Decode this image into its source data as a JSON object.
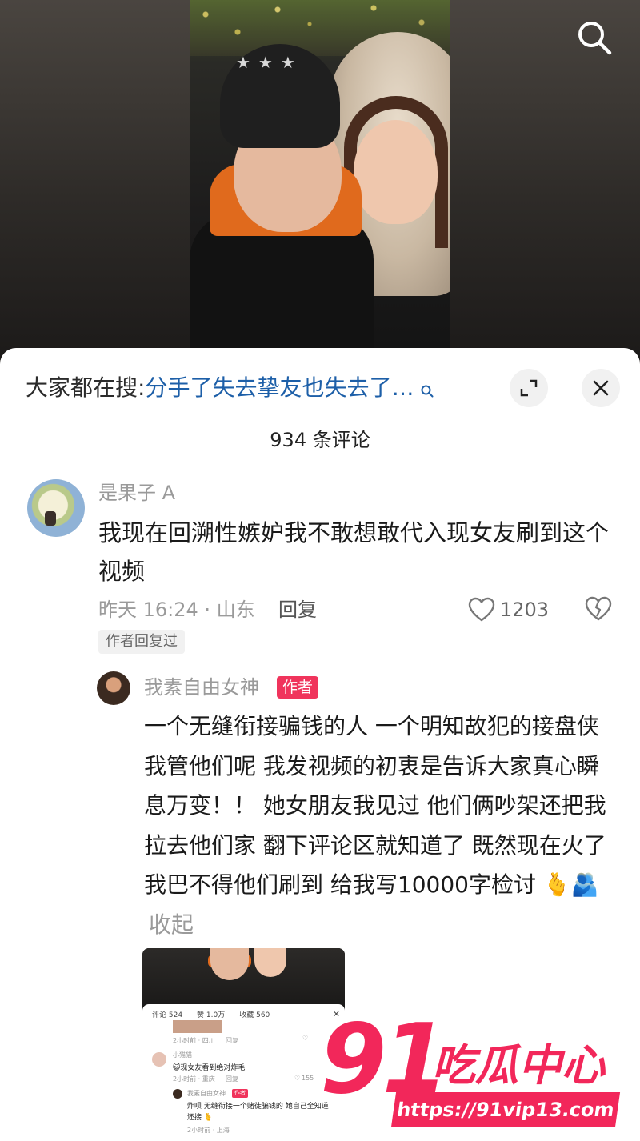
{
  "search": {
    "prefix": "大家都在搜:",
    "query": "分手了失去挚友也失去了…"
  },
  "comments_header": {
    "count_label": "934 条评论"
  },
  "comment": {
    "username": "是果子 A",
    "text": "我现在回溯性嫉妒我不敢想敢代入现女友刷到这个视频",
    "meta": "昨天 16:24 · 山东",
    "reply_label": "回复",
    "likes": "1203",
    "author_replied_tag": "作者回复过"
  },
  "reply": {
    "username": "我素自由女神",
    "author_badge": "作者",
    "text": "一个无缝衔接骗钱的人 一个明知故犯的接盘侠 我管他们呢 我发视频的初衷是告诉大家真心瞬息万变！！ 她女朋友我见过 他们俩吵架还把我拉去他们家 翻下评论区就知道了 既然现在火了 我巴不得他们刷到 给我写10000字检讨",
    "emoji": "🫰🫂",
    "collapse_label": "收起"
  },
  "embedded_screenshot": {
    "tabs": [
      "评论 524",
      "赞 1.0万",
      "收藏 560"
    ],
    "close": "✕",
    "row1_meta": "2小时前 · 四川",
    "row1_reply": "回复",
    "row2_user": "小猫猫",
    "row2_text": "😺现女友看到绝对炸毛",
    "row2_meta": "2小时前 · 重庆",
    "row2_reply": "回复",
    "row2_likes": "155",
    "row3_user": "我素自由女神",
    "row3_badge": "作者",
    "row3_text1": "炸呗 无缝衔接一个赌徒骗钱的 她自己全知道",
    "row3_text2": "还接 🫰",
    "row3_meta": "2小时前 · 上海"
  },
  "watermark": {
    "number": "91",
    "name": "吃瓜中心",
    "url": "https://91vip13.com"
  },
  "colors": {
    "link_blue": "#1d5fa8",
    "author_badge": "#f0345c",
    "watermark_pink": "#f2275a"
  }
}
